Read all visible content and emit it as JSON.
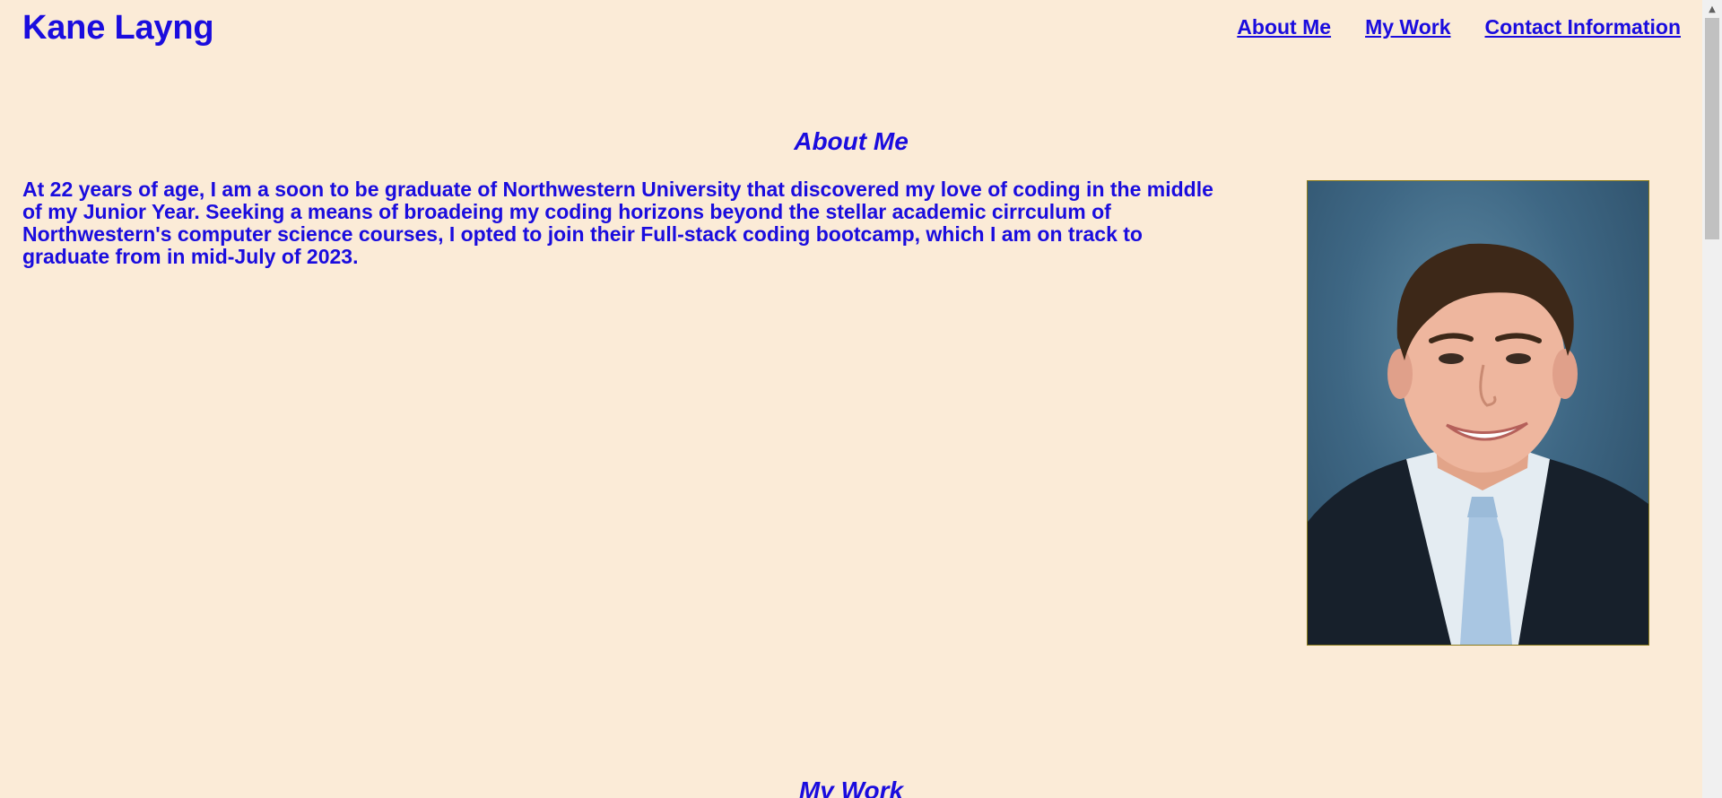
{
  "header": {
    "site_title": "Kane Layng",
    "nav": [
      {
        "label": "About Me"
      },
      {
        "label": "My Work"
      },
      {
        "label": "Contact Information"
      }
    ]
  },
  "about": {
    "title": "About Me",
    "text": "At 22 years of age, I am a soon to be graduate of Northwestern University that discovered my love of coding in the middle of my Junior Year. Seeking a means of broadeing my coding horizons beyond the stellar academic cirrculum of Northwestern's computer science courses, I opted to join their Full-stack coding bootcamp, which I am on track to graduate from in mid-July of 2023."
  },
  "work": {
    "title": "My Work"
  },
  "colors": {
    "background": "#fbebd7",
    "text": "#1a0cde"
  },
  "icons": {
    "scroll_up": "scroll-up-arrow-icon"
  }
}
